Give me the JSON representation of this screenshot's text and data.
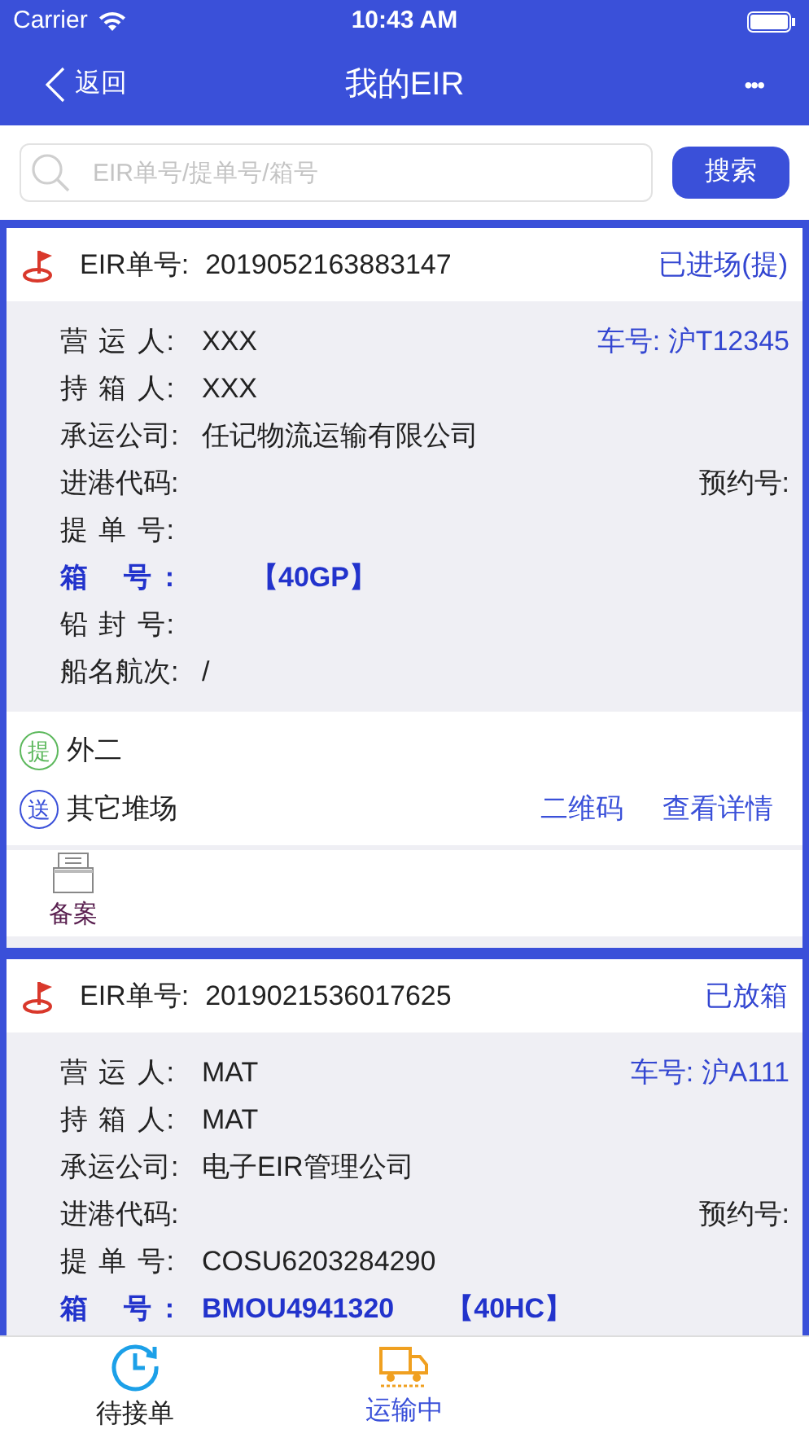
{
  "status_bar": {
    "carrier": "Carrier",
    "time": "10:43 AM"
  },
  "nav": {
    "back": "返回",
    "title": "我的EIR",
    "more": "•••"
  },
  "search": {
    "placeholder": "EIR单号/提单号/箱号",
    "button": "搜索"
  },
  "cards": [
    {
      "eir_label": "EIR单号:",
      "eir_no": "2019052163883147",
      "status": "已进场(提)",
      "fields": [
        {
          "label": "营 运 人:",
          "value": "XXX",
          "right": "车号: 沪T12345",
          "right_highlighted": true,
          "highlighted": false
        },
        {
          "label": "持 箱 人:",
          "value": "XXX",
          "highlighted": false
        },
        {
          "label": "承运公司:",
          "value": "任记物流运输有限公司",
          "highlighted": false
        },
        {
          "label": "进港代码:",
          "right": "预约号:",
          "right_highlighted": false,
          "highlighted": false
        },
        {
          "label": "提 单 号:",
          "highlighted": false
        },
        {
          "label": "箱 号:",
          "extra": "【40GP】",
          "highlighted": true
        },
        {
          "label": "铅 封 号:",
          "highlighted": false
        },
        {
          "label": "船名航次:",
          "value": "/",
          "highlighted": false
        }
      ],
      "places": [
        {
          "badge": "提",
          "color": "#5cb85c",
          "name": "外二"
        },
        {
          "badge": "送",
          "color": "#3a50d9",
          "name": "其它堆场"
        }
      ],
      "links": [
        "二维码",
        "查看详情"
      ],
      "actions": [
        "备案"
      ]
    },
    {
      "eir_label": "EIR单号:",
      "eir_no": "2019021536017625",
      "status": "已放箱",
      "fields": [
        {
          "label": "营 运 人:",
          "value": "MAT",
          "right": "车号: 沪A111",
          "right_highlighted": true,
          "highlighted": false
        },
        {
          "label": "持 箱 人:",
          "value": "MAT",
          "highlighted": false
        },
        {
          "label": "承运公司:",
          "value": "电子EIR管理公司",
          "highlighted": false
        },
        {
          "label": "进港代码:",
          "right": "预约号:",
          "right_highlighted": false,
          "highlighted": false
        },
        {
          "label": "提 单 号:",
          "value": "COSU6203284290",
          "highlighted": false
        },
        {
          "label": "箱 号:",
          "value": "BMOU4941320",
          "extra": "【40HC】",
          "highlighted": true
        }
      ]
    }
  ],
  "tabs": [
    {
      "label": "待接单",
      "kind": "clock",
      "selected": false
    },
    {
      "label": "运输中",
      "kind": "truck",
      "selected": true
    }
  ]
}
